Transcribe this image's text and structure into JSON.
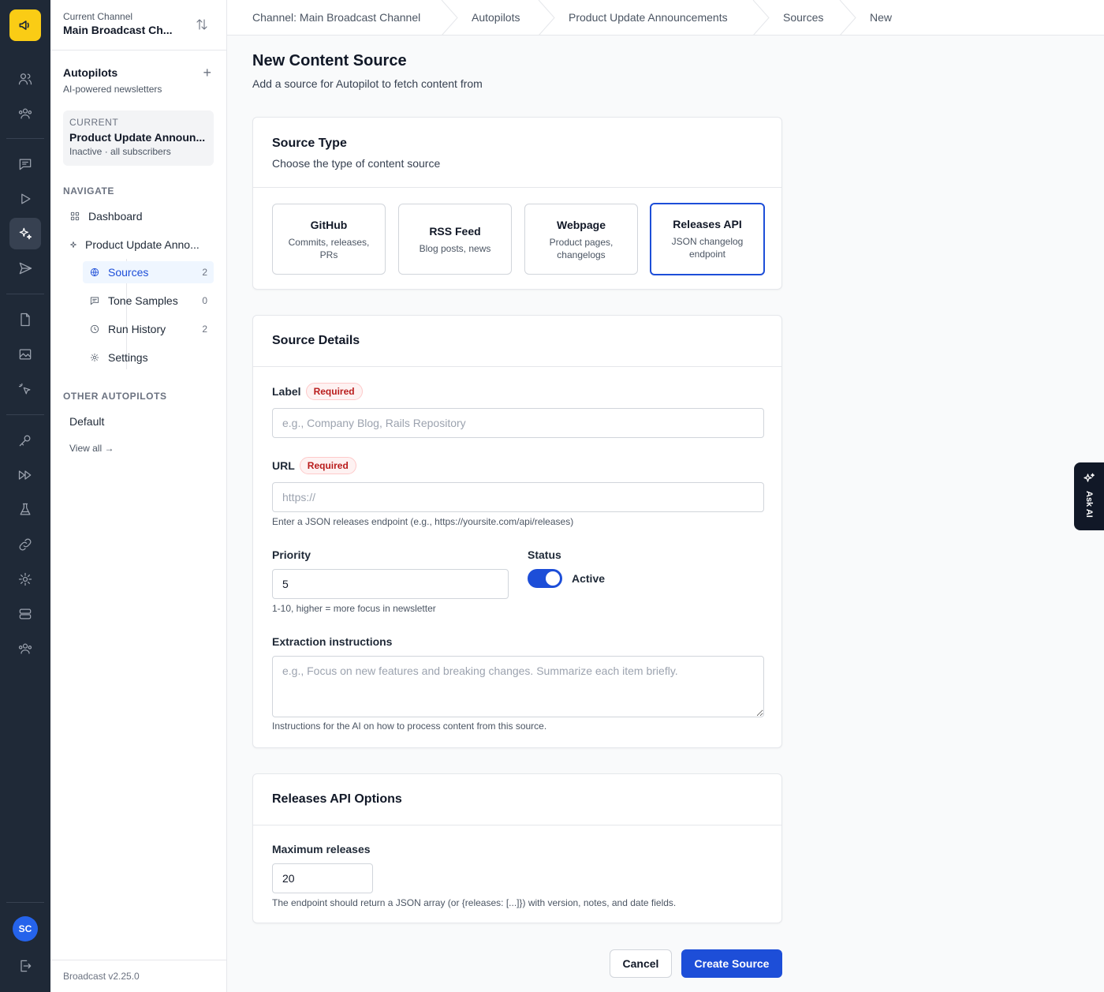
{
  "app": {
    "current_channel_label": "Current Channel",
    "current_channel_name": "Main Broadcast Ch...",
    "user_initials": "SC",
    "version": "Broadcast v2.25.0"
  },
  "sidebar": {
    "autopilots_title": "Autopilots",
    "autopilots_subtitle": "AI-powered newsletters",
    "current_label": "CURRENT",
    "current_name": "Product Update Announ...",
    "current_meta": "Inactive · all subscribers",
    "navigate_label": "NAVIGATE",
    "dashboard": "Dashboard",
    "autopilot_item": "Product Update Anno...",
    "sub_items": [
      {
        "label": "Sources",
        "count": "2"
      },
      {
        "label": "Tone Samples",
        "count": "0"
      },
      {
        "label": "Run History",
        "count": "2"
      },
      {
        "label": "Settings",
        "count": ""
      }
    ],
    "other_label": "OTHER AUTOPILOTS",
    "other_items": [
      "Default"
    ],
    "view_all": "View all →"
  },
  "breadcrumb": [
    "Channel: Main Broadcast Channel",
    "Autopilots",
    "Product Update Announcements",
    "Sources",
    "New"
  ],
  "page": {
    "title": "New Content Source",
    "subtitle": "Add a source for Autopilot to fetch content from"
  },
  "source_type": {
    "title": "Source Type",
    "subtitle": "Choose the type of content source",
    "options": [
      {
        "title": "GitHub",
        "desc": "Commits, releases, PRs"
      },
      {
        "title": "RSS Feed",
        "desc": "Blog posts, news"
      },
      {
        "title": "Webpage",
        "desc": "Product pages, changelogs"
      },
      {
        "title": "Releases API",
        "desc": "JSON changelog endpoint"
      }
    ],
    "selected": "Releases API"
  },
  "details": {
    "title": "Source Details",
    "required_badge": "Required",
    "label_label": "Label",
    "label_placeholder": "e.g., Company Blog, Rails Repository",
    "url_label": "URL",
    "url_placeholder": "https://",
    "url_help": "Enter a JSON releases endpoint (e.g., https://yoursite.com/api/releases)",
    "priority_label": "Priority",
    "priority_value": "5",
    "priority_help": "1-10, higher = more focus in newsletter",
    "status_label": "Status",
    "status_value": "Active",
    "extraction_label": "Extraction instructions",
    "extraction_placeholder": "e.g., Focus on new features and breaking changes. Summarize each item briefly.",
    "extraction_help": "Instructions for the AI on how to process content from this source."
  },
  "releases_options": {
    "title": "Releases API Options",
    "max_label": "Maximum releases",
    "max_value": "20",
    "help": "The endpoint should return a JSON array (or {releases: [...]}) with version, notes, and date fields."
  },
  "actions": {
    "cancel": "Cancel",
    "create": "Create Source"
  },
  "ask_ai": "Ask AI",
  "colors": {
    "rail_bg": "#1f2937",
    "logo": "#facc15",
    "accent": "#1d4ed8",
    "required": "#b91c1c"
  }
}
